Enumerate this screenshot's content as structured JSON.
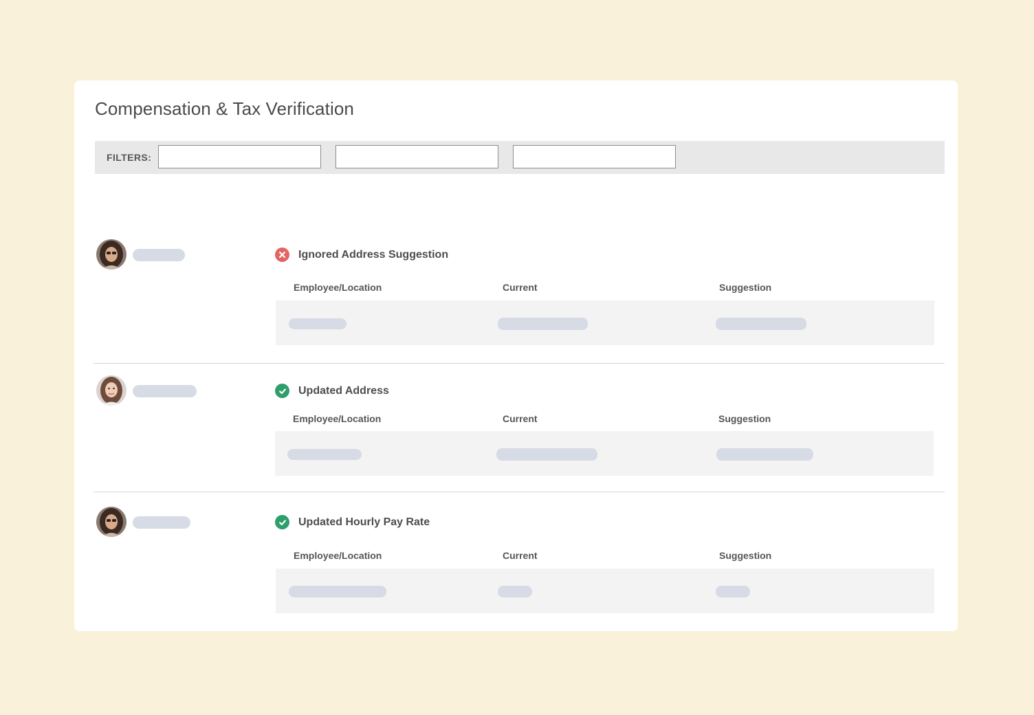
{
  "page": {
    "title": "Compensation & Tax Verification"
  },
  "filters": {
    "label": "FILTERS:",
    "inputs": [
      {
        "value": "",
        "placeholder": ""
      },
      {
        "value": "",
        "placeholder": ""
      },
      {
        "value": "",
        "placeholder": ""
      }
    ]
  },
  "records": [
    {
      "status": "error",
      "status_icon": "close-circle-icon",
      "status_color": "#e26463",
      "status_text": "Ignored Address Suggestion",
      "columns": [
        "Employee/Location",
        "Current",
        "Suggestion"
      ]
    },
    {
      "status": "success",
      "status_icon": "check-circle-icon",
      "status_color": "#2e9e6b",
      "status_text": "Updated Address",
      "columns": [
        "Employee/Location",
        "Current",
        "Suggestion"
      ]
    },
    {
      "status": "success",
      "status_icon": "check-circle-icon",
      "status_color": "#2e9e6b",
      "status_text": "Updated Hourly Pay Rate",
      "columns": [
        "Employee/Location",
        "Current",
        "Suggestion"
      ]
    }
  ],
  "colors": {
    "background": "#faf1da",
    "card": "#ffffff",
    "filter_bar": "#e8e8e8",
    "placeholder_pill": "#d6dbe5",
    "detail_box": "#f3f3f3"
  }
}
